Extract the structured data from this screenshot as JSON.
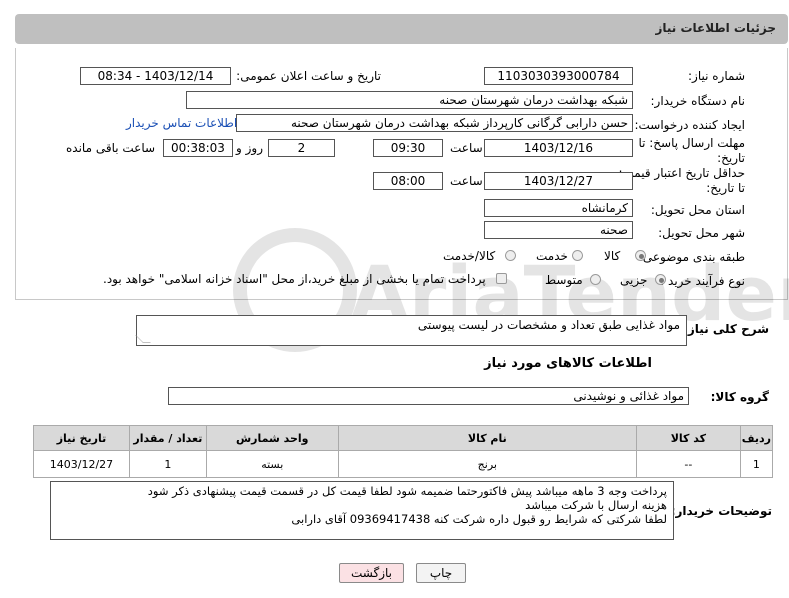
{
  "header": {
    "title": "جزئیات اطلاعات نیاز"
  },
  "fields": {
    "need_number": {
      "label": "شماره نیاز:",
      "value": "1103030393000784"
    },
    "announce": {
      "label": "تاریخ و ساعت اعلان عمومی:",
      "value": "1403/12/14 - 08:34"
    },
    "buyer_org": {
      "label": "نام دستگاه خریدار:",
      "value": "شبکه بهداشت درمان شهرستان صحنه"
    },
    "requester": {
      "label": "ایجاد کننده درخواست:",
      "value": "حسن دارابی گرگانی کارپرداز شبکه بهداشت درمان شهرستان صحنه",
      "contact_link": "اطلاعات تماس خریدار"
    },
    "deadline": {
      "label": "مهلت ارسال پاسخ: تا تاریخ:",
      "date": "1403/12/16",
      "time_label": "ساعت",
      "time": "09:30",
      "days": "2",
      "days_label": "روز و",
      "remaining": "00:38:03",
      "remaining_label": "ساعت باقی مانده"
    },
    "validity": {
      "label": "حداقل تاریخ اعتبار قیمت: تا تاریخ:",
      "date": "1403/12/27",
      "time_label": "ساعت",
      "time": "08:00"
    },
    "province": {
      "label": "استان محل تحویل:",
      "value": "کرمانشاه"
    },
    "city": {
      "label": "شهر محل تحویل:",
      "value": "صحنه"
    },
    "category": {
      "label": "طبقه بندی موضوعی:",
      "options": [
        "کالا",
        "خدمت",
        "کالا/خدمت"
      ],
      "selected": "کالا"
    },
    "purchase_type": {
      "label": "نوع فرآیند خرید :",
      "options": [
        "جزیی",
        "متوسط"
      ],
      "selected": "جزیی",
      "note": "پرداخت تمام یا بخشی از مبلغ خرید،از محل \"اسناد خزانه اسلامی\" خواهد بود."
    }
  },
  "description": {
    "label": "شرح کلی نیاز:",
    "value": "مواد غذایی طبق تعداد و مشخصات در لیست پیوستی"
  },
  "goods_info": {
    "title": "اطلاعات کالاهای مورد نیاز"
  },
  "goods_group": {
    "label": "گروه کالا:",
    "value": "مواد غذائی و نوشیدنی"
  },
  "table": {
    "headers": [
      "ردیف",
      "کد کالا",
      "نام کالا",
      "واحد شمارش",
      "تعداد / مقدار",
      "تاریخ نیاز"
    ],
    "rows": [
      [
        "1",
        "--",
        "برنج",
        "بسته",
        "1",
        "1403/12/27"
      ]
    ]
  },
  "buyer_notes": {
    "label": "توضیحات خریدار:",
    "lines": [
      "پرداخت وجه 3 ماهه میباشد پیش فاکتورحتما ضمیمه شود لطفا قیمت کل در قسمت قیمت پیشنهادی ذکر شود",
      "هزینه ارسال با شرکت میباشد",
      "لطفا شرکتی که شرایط رو قبول داره شرکت کنه   09369417438 آقای دارابی"
    ]
  },
  "buttons": {
    "print": "چاپ",
    "back": "بازگشت"
  },
  "watermark": "AriaTender.net"
}
